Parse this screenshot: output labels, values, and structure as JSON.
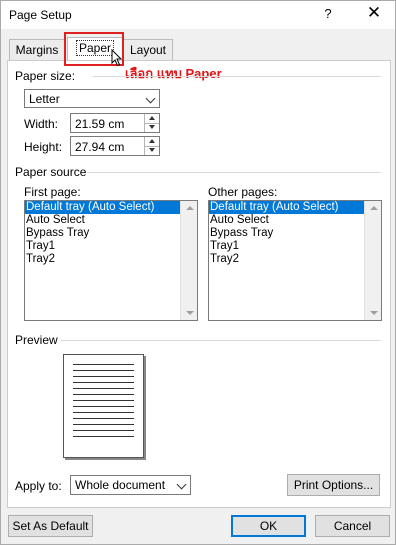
{
  "window": {
    "title": "Page Setup",
    "help_label": "?",
    "close_label": "✕"
  },
  "tabs": [
    {
      "label": "Margins",
      "active": false
    },
    {
      "label": "Paper",
      "active": true
    },
    {
      "label": "Layout",
      "active": false
    }
  ],
  "annotation": {
    "text": "เลือก แทบ Paper",
    "color": "#e01414"
  },
  "paper_size": {
    "heading": "Paper size:",
    "selected": "Letter",
    "width_label": "Width:",
    "width_value": "21.59 cm",
    "height_label": "Height:",
    "height_value": "27.94 cm"
  },
  "paper_source": {
    "heading": "Paper source",
    "first_page_label": "First page:",
    "other_pages_label": "Other pages:",
    "first_page_items": [
      "Default tray (Auto Select)",
      "Auto Select",
      "Bypass Tray",
      "Tray1",
      "Tray2"
    ],
    "other_pages_items": [
      "Default tray (Auto Select)",
      "Auto Select",
      "Bypass Tray",
      "Tray1",
      "Tray2"
    ],
    "selected_index": 0
  },
  "preview": {
    "heading": "Preview"
  },
  "apply": {
    "label": "Apply to:",
    "selected": "Whole document"
  },
  "buttons": {
    "print_options": "Print Options...",
    "set_default": "Set As Default",
    "ok": "OK",
    "cancel": "Cancel"
  },
  "colors": {
    "selection": "#0078d7",
    "highlight_box": "#e02020",
    "dialog_bg": "#f0f0f0"
  }
}
